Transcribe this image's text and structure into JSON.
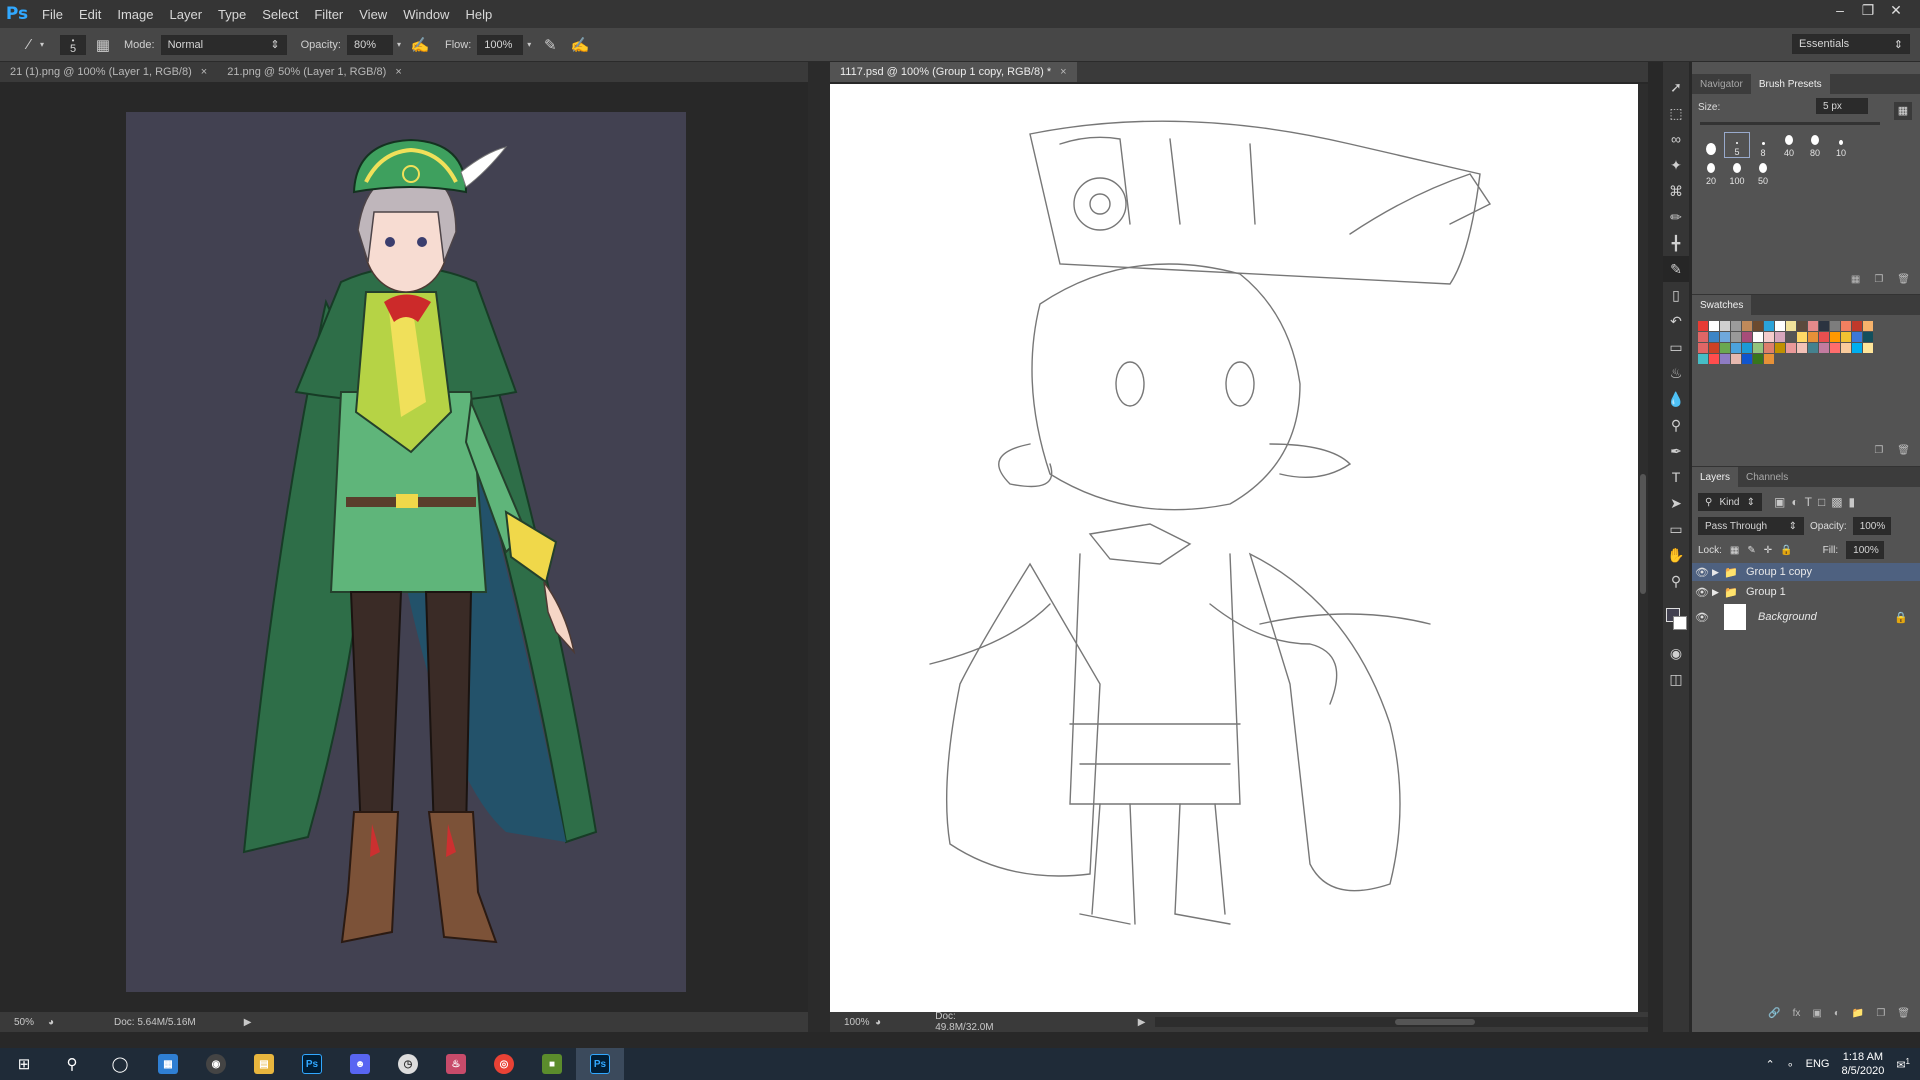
{
  "app": {
    "logo": "Ps"
  },
  "menu": [
    "File",
    "Edit",
    "Image",
    "Layer",
    "Type",
    "Select",
    "Filter",
    "View",
    "Window",
    "Help"
  ],
  "options": {
    "brush_size": "5",
    "mode_label": "Mode:",
    "mode_value": "Normal",
    "opacity_label": "Opacity:",
    "opacity_value": "80%",
    "flow_label": "Flow:",
    "flow_value": "100%",
    "workspace": "Essentials"
  },
  "left_doc": {
    "tabs": [
      {
        "label": "21 (1).png @ 100% (Layer 1, RGB/8)"
      },
      {
        "label": "21.png @ 50% (Layer 1, RGB/8)"
      }
    ],
    "zoom": "50%",
    "doc_info": "Doc: 5.64M/5.16M"
  },
  "right_doc": {
    "tab": "1117.psd @ 100% (Group 1 copy, RGB/8) *",
    "zoom": "100%",
    "doc_info": "Doc: 49.8M/32.0M"
  },
  "panels": {
    "brush_tabs": [
      "Navigator",
      "Brush Presets"
    ],
    "size_label": "Size:",
    "size_value": "5 px",
    "brushes": [
      "5",
      "8",
      "40",
      "80",
      "10",
      "20",
      "100",
      "50"
    ],
    "swatches_tab": "Swatches",
    "swatch_colors": [
      "#e73b34",
      "#ffffff",
      "#d0d0d0",
      "#9b9b9b",
      "#c08a5a",
      "#6b4a2f",
      "#2aa3d9",
      "#ffffff",
      "#f2e29a",
      "#5c4a3d",
      "#e58a8a",
      "#2b3340",
      "#7d7d7d",
      "#f08060",
      "#c0392b",
      "#f6b26b",
      "#e06666",
      "#3d85c6",
      "#6fa8dc",
      "#999999",
      "#a64d79",
      "#ffffff",
      "#f4cccc",
      "#d5a6bd",
      "#555555",
      "#ffd966",
      "#e69138",
      "#e94f4f",
      "#ff9900",
      "#f1c232",
      "#3c78d8",
      "#134f5c",
      "#e06666",
      "#cc4125",
      "#6aa84f",
      "#4ca3dd",
      "#1c9ad6",
      "#93c47d",
      "#dd7e6b",
      "#bf9000",
      "#ea9999",
      "#f2c1b7",
      "#45818e",
      "#c27ba0",
      "#ff6d6d",
      "#f9cb9c",
      "#00aeef",
      "#ffe599",
      "#46bdc6",
      "#ff4d4d",
      "#8e7cc3",
      "#e6b8af",
      "#1155cc",
      "#38761d",
      "#e69138"
    ],
    "layers_tabs": [
      "Layers",
      "Channels"
    ],
    "kind_label": "Kind",
    "blend_mode": "Pass Through",
    "opacity_label": "Opacity:",
    "opacity_value": "100%",
    "lock_label": "Lock:",
    "fill_label": "Fill:",
    "fill_value": "100%",
    "layers": [
      {
        "name": "Group 1 copy"
      },
      {
        "name": "Group 1"
      },
      {
        "name": "Background"
      }
    ]
  },
  "taskbar": {
    "lang": "ENG",
    "time": "1:18 AM",
    "date": "8/5/2020",
    "notif_count": "1"
  }
}
